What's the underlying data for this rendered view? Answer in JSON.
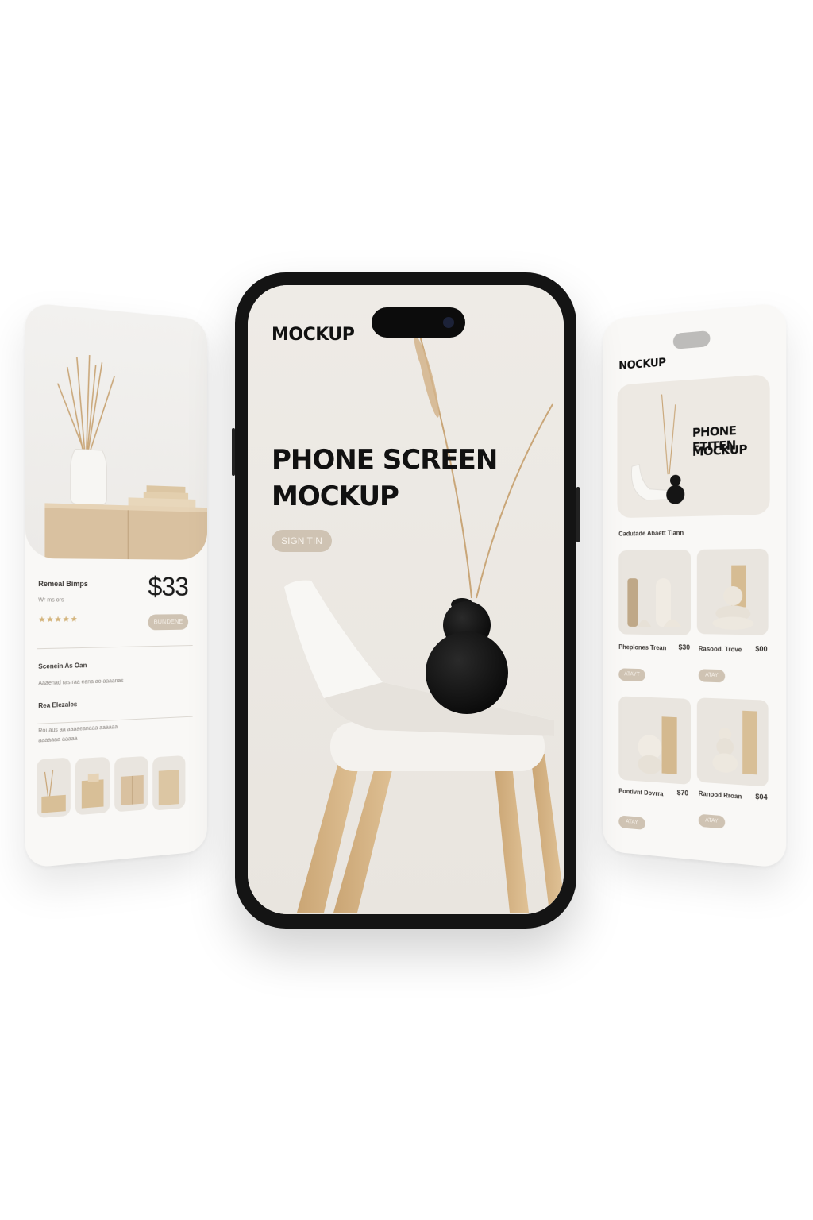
{
  "center": {
    "brand": "MOCKUP",
    "headline_line1": "PHONE SCREEN",
    "headline_line2": "MOCKUP",
    "cta_label": "SIGN TIN"
  },
  "left": {
    "product_name": "Remeal Bimps",
    "subtitle": "Wr ms ors",
    "price": "$33",
    "rating": "★★★★★",
    "cta_label": "BUNDENE",
    "section1_title": "Scenein As Oan",
    "section1_text": "Aaaenad ras raa eana ao aaaanas",
    "section2_title": "Rea Elezales",
    "section2_text": "Rouaus aa aaaaeanaaa aaaaaa",
    "section2_text2": "aaaaaaa aaaaa"
  },
  "right": {
    "brand": "NOCKUP",
    "banner_line1": "PHONE ETITEN",
    "banner_line2": "MOCKUP",
    "section_title": "Cadutade Abaett Tlann",
    "products": [
      {
        "name": "Pheplones Trean",
        "price": "$30",
        "cta": "ATAYT"
      },
      {
        "name": "Rasood. Trove",
        "price": "$00",
        "cta": "ATAY"
      },
      {
        "name": "Pontivnt Dovrra",
        "price": "$70",
        "cta": "ATAY"
      },
      {
        "name": "Ranood Rroan",
        "price": "$04",
        "cta": "ATAY"
      }
    ]
  },
  "colors": {
    "accent": "#cfc3b3",
    "screen_bg": "#ece9e4",
    "frame": "#141414",
    "wood": "#d8bf97"
  }
}
